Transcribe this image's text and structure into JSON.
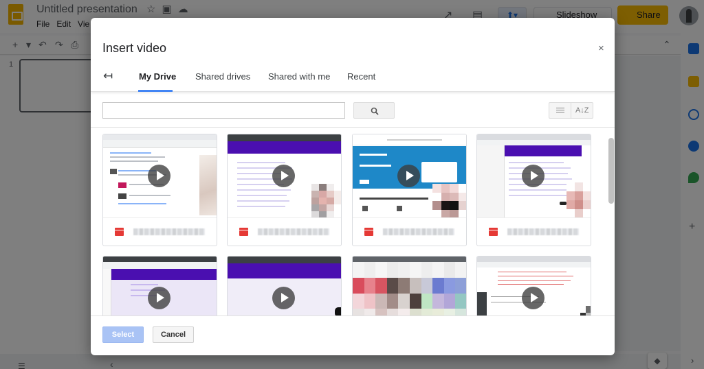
{
  "app": {
    "doc_title": "Untitled presentation",
    "menu": [
      "File",
      "Edit",
      "Vie"
    ],
    "slideshow_label": "Slideshow",
    "share_label": "Share",
    "slide_number": "1"
  },
  "dialog": {
    "title": "Insert video",
    "close_label": "×",
    "tabs": [
      "My Drive",
      "Shared drives",
      "Shared with me",
      "Recent"
    ],
    "active_tab": "My Drive",
    "search": {
      "value": "",
      "placeholder": ""
    },
    "select_label": "Select",
    "cancel_label": "Cancel",
    "sort_label": "A↓Z"
  },
  "colors": {
    "accent": "#4285f4",
    "share": "#fbbc04",
    "select_disabled": "#a9c3f5",
    "video_file": "#e53935"
  },
  "icons": {
    "back": "back-arrow-icon",
    "search": "search-icon",
    "list_view": "list-view-icon",
    "sort": "sort-az-icon",
    "play": "play-icon",
    "close": "close-icon"
  }
}
